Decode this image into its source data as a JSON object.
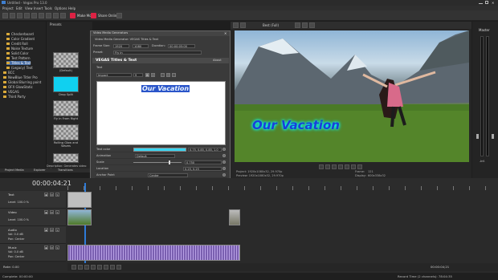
{
  "app": {
    "title": "Untitled - Vegas Pro 13.0",
    "menu": [
      "Project",
      "Edit",
      "View",
      "Insert",
      "Tools",
      "Options",
      "Help"
    ]
  },
  "toolbar": {
    "make_movie_label": "Make Movie",
    "share_online_label": "Share Online"
  },
  "explorer": {
    "tree": [
      "Checkerboard",
      "Color Gradient",
      "Credit Roll",
      "Noise Texture",
      "Solid Color",
      "Test Pattern",
      "Titles & Text",
      "(Legacy) Text",
      "BCC",
      "NewBlue Titler Pro",
      "Global Blurring point",
      "OFX GlowStatic",
      "VEGAS",
      "Third Party"
    ],
    "presets_header": "Presets",
    "presets": [
      {
        "label": "(Default)"
      },
      {
        "label": "Drop Split"
      },
      {
        "label": "Fly In From Right"
      },
      {
        "label": "Rolling Glow and Waves"
      },
      {
        "label": "Slip Lift"
      }
    ],
    "description": "Description: Generates video text.",
    "tabs": [
      "Project Media",
      "Explorer",
      "Transitions",
      "Video FX",
      "Media Generators"
    ]
  },
  "dialog": {
    "title": "Video Media Generators",
    "subtitle": "Video Media Generator: VEGAS Titles & Text",
    "frame_size_label": "Frame Size:",
    "frame_w": "1920",
    "frame_h": "1080",
    "duration_label": "Duration:",
    "duration": "00:00:05:00",
    "preset_label": "Preset:",
    "preset_value": "Fly In",
    "plugin_header": "VEGAS Titles & Text",
    "about_label": "About",
    "text_label": "Text",
    "font_value": "Impact",
    "font_size": "9",
    "canvas_text": "Our Vacation",
    "props": [
      {
        "label": "Text color",
        "value": "0.75, 0.85, 0.85, 1.0"
      },
      {
        "label": "Animation",
        "value": "Default"
      },
      {
        "label": "Scale",
        "value": "0.750"
      },
      {
        "label": "Location",
        "value": "0.25, 0.25"
      },
      {
        "label": "Anchor Point",
        "value": "Center"
      }
    ],
    "sections": [
      "Advanced",
      "Outline",
      "Shadow"
    ],
    "shadow": [
      {
        "label": "Shadow enable",
        "value": ""
      },
      {
        "label": "Shadow color",
        "value": "0.0, 0.0, 0.0"
      },
      {
        "label": "Shadow offset X",
        "value": "0.200"
      },
      {
        "label": "Shadow offset Y",
        "value": "0.360"
      },
      {
        "label": "Shadow blur",
        "value": "0.400"
      }
    ]
  },
  "preview": {
    "best_label": "Best (Full)",
    "overlay_text": "Our Vacation",
    "project_info": "Project: 1920x1080x32, 29.970p",
    "preview_info": "Preview: 1920x1080x32, 29.970p",
    "display_info": "Display: 600x338x32",
    "frame_label": "Frame:",
    "frame_value": "121",
    "displ_label": "Display:",
    "displ_value": "600x338x32"
  },
  "meters": {
    "title": "Master",
    "value": "-Inf."
  },
  "timeline": {
    "timecode": "00:00:04:21",
    "tracks": [
      {
        "name": "Text",
        "level": "Level: 100.0 %"
      },
      {
        "name": "Video",
        "level": "Level: 100.0 %"
      },
      {
        "name": "Audio",
        "vol": "Vol: 0.0 dB",
        "pan": "Pan: Center"
      },
      {
        "name": "Music",
        "vol": "Vol: 0.0 dB",
        "pan": "Pan: Center"
      }
    ],
    "rate": "Rate: 0.00",
    "end_time": "00:00:04;21"
  },
  "status": {
    "left": "Complete: 00:00:00",
    "right": "Record Time (2 channels): 78:04:35"
  }
}
